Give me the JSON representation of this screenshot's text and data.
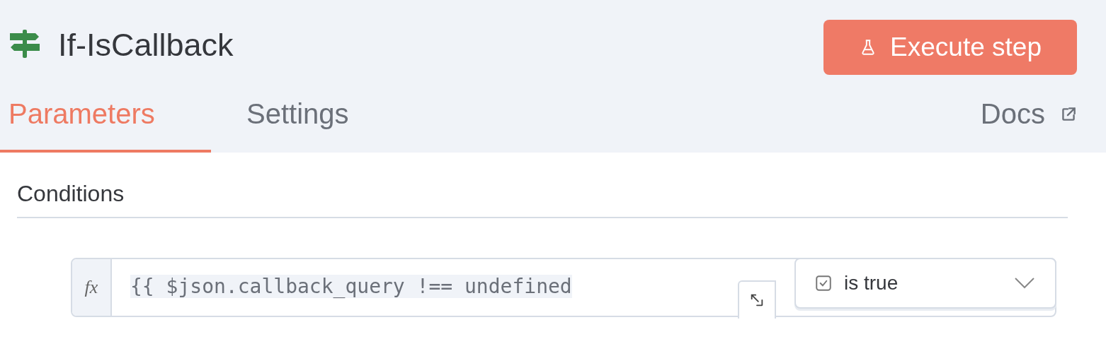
{
  "node": {
    "title": "If-IsCallback"
  },
  "execute_button": {
    "label": "Execute step"
  },
  "tabs": [
    {
      "label": "Parameters",
      "selected": true
    },
    {
      "label": "Settings",
      "selected": false
    }
  ],
  "docs_link": {
    "label": "Docs"
  },
  "section": {
    "title": "Conditions"
  },
  "condition": {
    "prefix": "fx",
    "expression": "{{ $json.callback_query !== undefined",
    "operator": "is true"
  }
}
